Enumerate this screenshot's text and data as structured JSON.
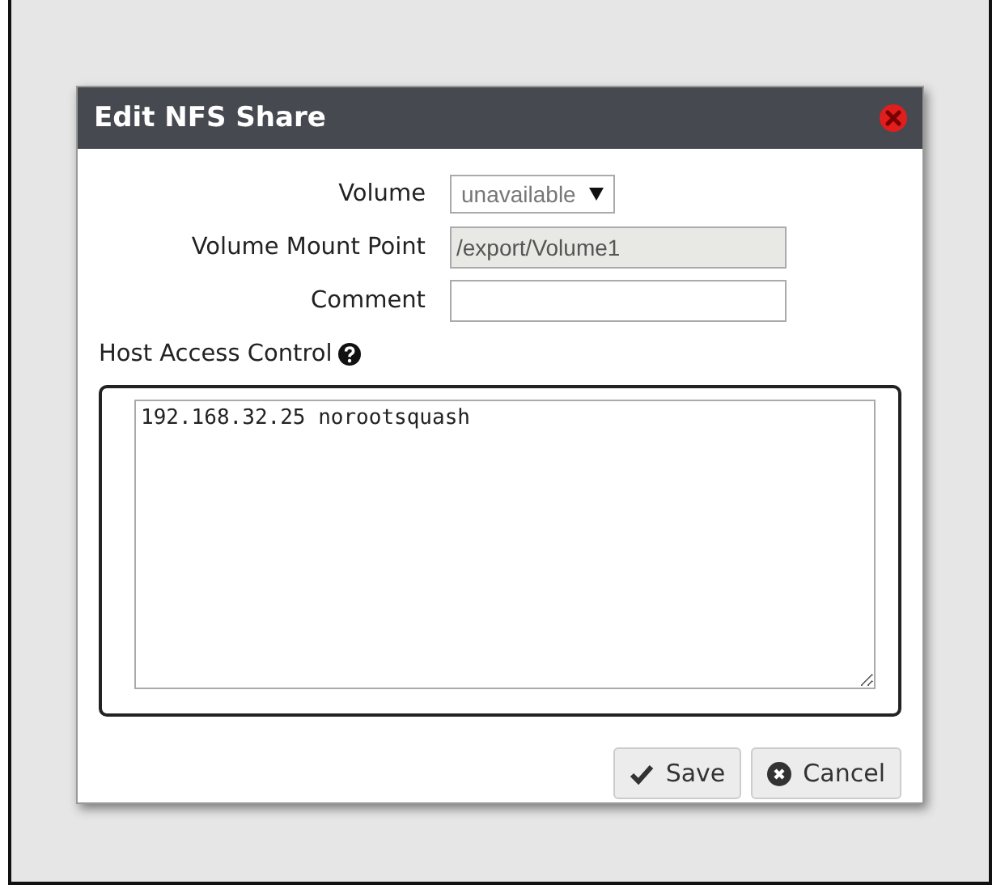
{
  "dialog": {
    "title": "Edit NFS Share"
  },
  "fields": [
    {
      "label": "Volume",
      "kind": "select",
      "value": "unavailable",
      "disabled": true
    },
    {
      "label": "Volume Mount Point",
      "kind": "text",
      "value": "/export/Volume1",
      "disabled": true
    },
    {
      "label": "Comment",
      "kind": "text",
      "disabled": false
    }
  ],
  "host_access": {
    "label": "Host Access Control",
    "value": "192.168.32.25 norootsquash"
  },
  "buttons": [
    {
      "label": "Save",
      "kind": "save"
    },
    {
      "label": "Cancel",
      "kind": "cancel"
    }
  ]
}
